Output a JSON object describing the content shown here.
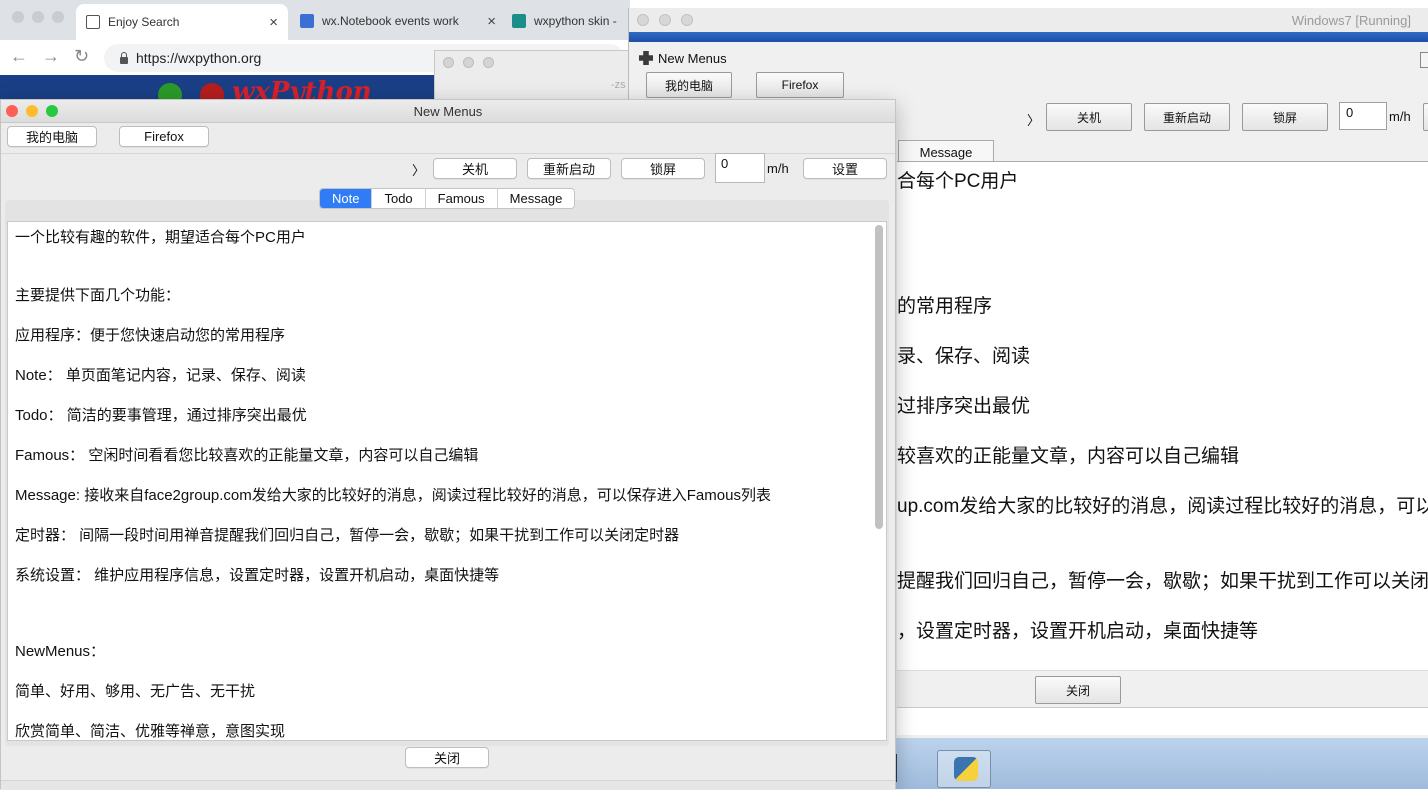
{
  "browser": {
    "tabs": [
      {
        "title": "Enjoy Search"
      },
      {
        "title": "wx.Notebook events work"
      },
      {
        "title": "wxpython skin -"
      }
    ],
    "url": "https://wxpython.org",
    "banner_logo": "wxPython"
  },
  "bg_window": {
    "fragment": "-zs"
  },
  "vbox": {
    "title": "Windows7 [Running]",
    "guest_window_title": "New Menus",
    "buttons": {
      "my_computer": "我的电脑",
      "firefox": "Firefox",
      "shutdown": "关机",
      "restart": "重新启动",
      "lock": "锁屏"
    },
    "arrow": "〉",
    "timer_value": "0",
    "unit": "m/h",
    "tab_message": "Message",
    "lines": [
      "合每个PC用户",
      "的常用程序",
      "录、保存、阅读",
      "过排序突出最优",
      "较喜欢的正能量文章，内容可以自己编辑",
      "up.com发给大家的比较好的消息，阅读过程比较好的消息，可以",
      "提醒我们回归自己，暂停一会，歇歇；如果干扰到工作可以关闭",
      "，设置定时器，设置开机启动，桌面快捷等"
    ],
    "close_button": "关闭"
  },
  "app": {
    "title": "New Menus",
    "colors": {
      "tab_selected": "#2f7cf6",
      "close": "#fe5f57",
      "minimize": "#febc2e",
      "zoom": "#28c840"
    },
    "toolbar": {
      "my_computer": "我的电脑",
      "firefox": "Firefox",
      "arrow": "〉",
      "shutdown": "关机",
      "restart": "重新启动",
      "lock": "锁屏",
      "timer_value": "0",
      "unit": "m/h",
      "settings": "设置"
    },
    "tabs": [
      "Note",
      "Todo",
      "Famous",
      "Message"
    ],
    "selected_tab": "Note",
    "note_lines": [
      "一个比较有趣的软件，期望适合每个PC用户",
      "主要提供下面几个功能：",
      "应用程序：便于您快速启动您的常用程序",
      "Note： 单页面笔记内容，记录、保存、阅读",
      "Todo： 简洁的要事管理，通过排序突出最优",
      "Famous： 空闲时间看看您比较喜欢的正能量文章，内容可以自己编辑",
      "Message: 接收来自face2group.com发给大家的比较好的消息，阅读过程比较好的消息，可以保存进入Famous列表",
      "定时器： 间隔一段时间用禅音提醒我们回归自己，暂停一会，歇歇；如果干扰到工作可以关闭定时器",
      "系统设置： 维护应用程序信息，设置定时器，设置开机启动，桌面快捷等",
      "NewMenus：",
      "简单、好用、够用、无广告、无干扰",
      "欣赏简单、简洁、优雅等禅意，意图实现"
    ],
    "close_button": "关闭"
  }
}
